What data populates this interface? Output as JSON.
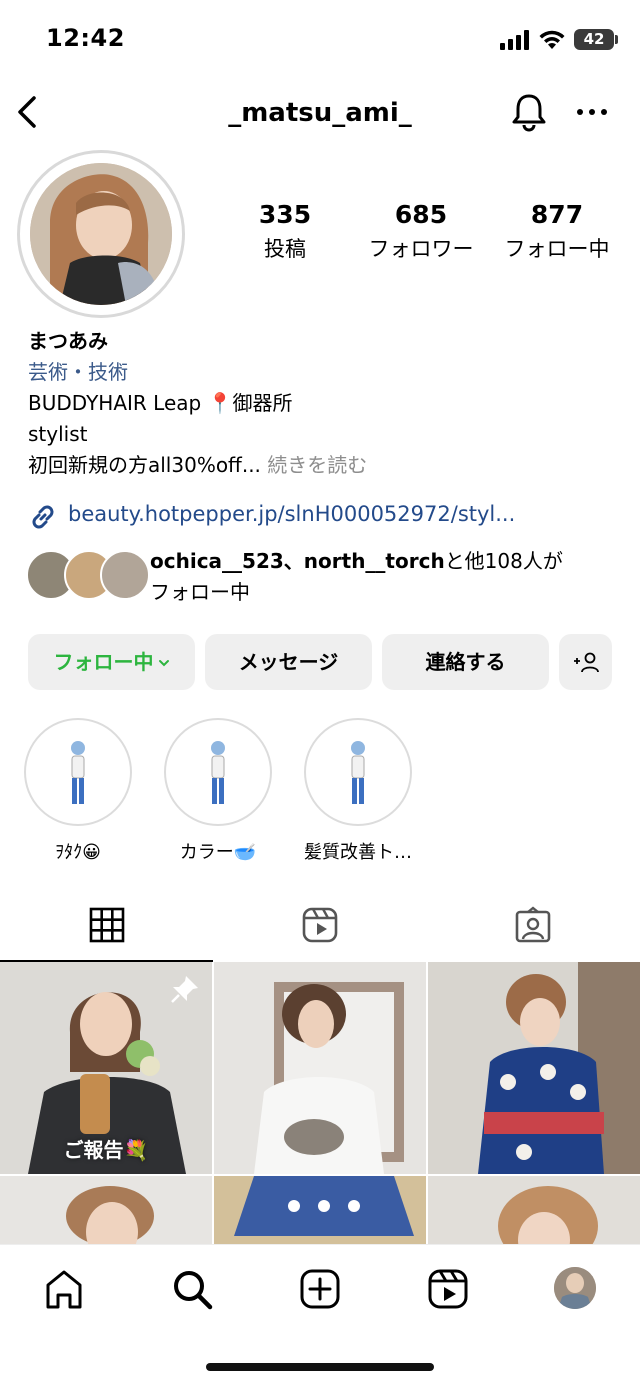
{
  "status_bar": {
    "time": "12:42",
    "battery": "42"
  },
  "nav": {
    "username": "_matsu_ami_",
    "back_icon": "chevron-left-icon",
    "bell_icon": "bell-icon",
    "more_icon": "more-icon"
  },
  "profile": {
    "stats": [
      {
        "value": "335",
        "label": "投稿"
      },
      {
        "value": "685",
        "label": "フォロワー"
      },
      {
        "value": "877",
        "label": "フォロー中"
      }
    ],
    "display_name": "まつあみ",
    "category": "芸術・技術",
    "bio_line1": "BUDDYHAIR Leap 📍御器所",
    "bio_line2": "stylist",
    "bio_line3": "初回新規の方all30%off...",
    "read_more": "続きを読む",
    "link": "beauty.hotpepper.jp/slnH000052972/styl...",
    "followed_by_users": "ochica__523、north__torch",
    "followed_by_rest": "と他108人が",
    "followed_by_line2": "フォロー中"
  },
  "buttons": {
    "follow": "フォロー中",
    "message": "メッセージ",
    "contact": "連絡する",
    "add_user": "+ユーザー"
  },
  "highlights": [
    {
      "label": "ｦﾀｸ😀"
    },
    {
      "label": "カラー🥣"
    },
    {
      "label": "髪質改善ト…"
    }
  ],
  "tabs": [
    "grid-icon",
    "reels-icon",
    "tagged-icon"
  ],
  "posts": [
    {
      "caption": "ご報告💐",
      "pinned": true
    },
    {
      "caption": "",
      "pinned": false
    },
    {
      "caption": "",
      "pinned": false
    }
  ],
  "bottom_nav": [
    "home-icon",
    "search-icon",
    "create-icon",
    "reels-icon",
    "profile-avatar"
  ],
  "colors": {
    "link": "#234a8a",
    "category": "#3b5a8a",
    "follow_green": "#2db53f",
    "button_bg": "#efefef"
  }
}
